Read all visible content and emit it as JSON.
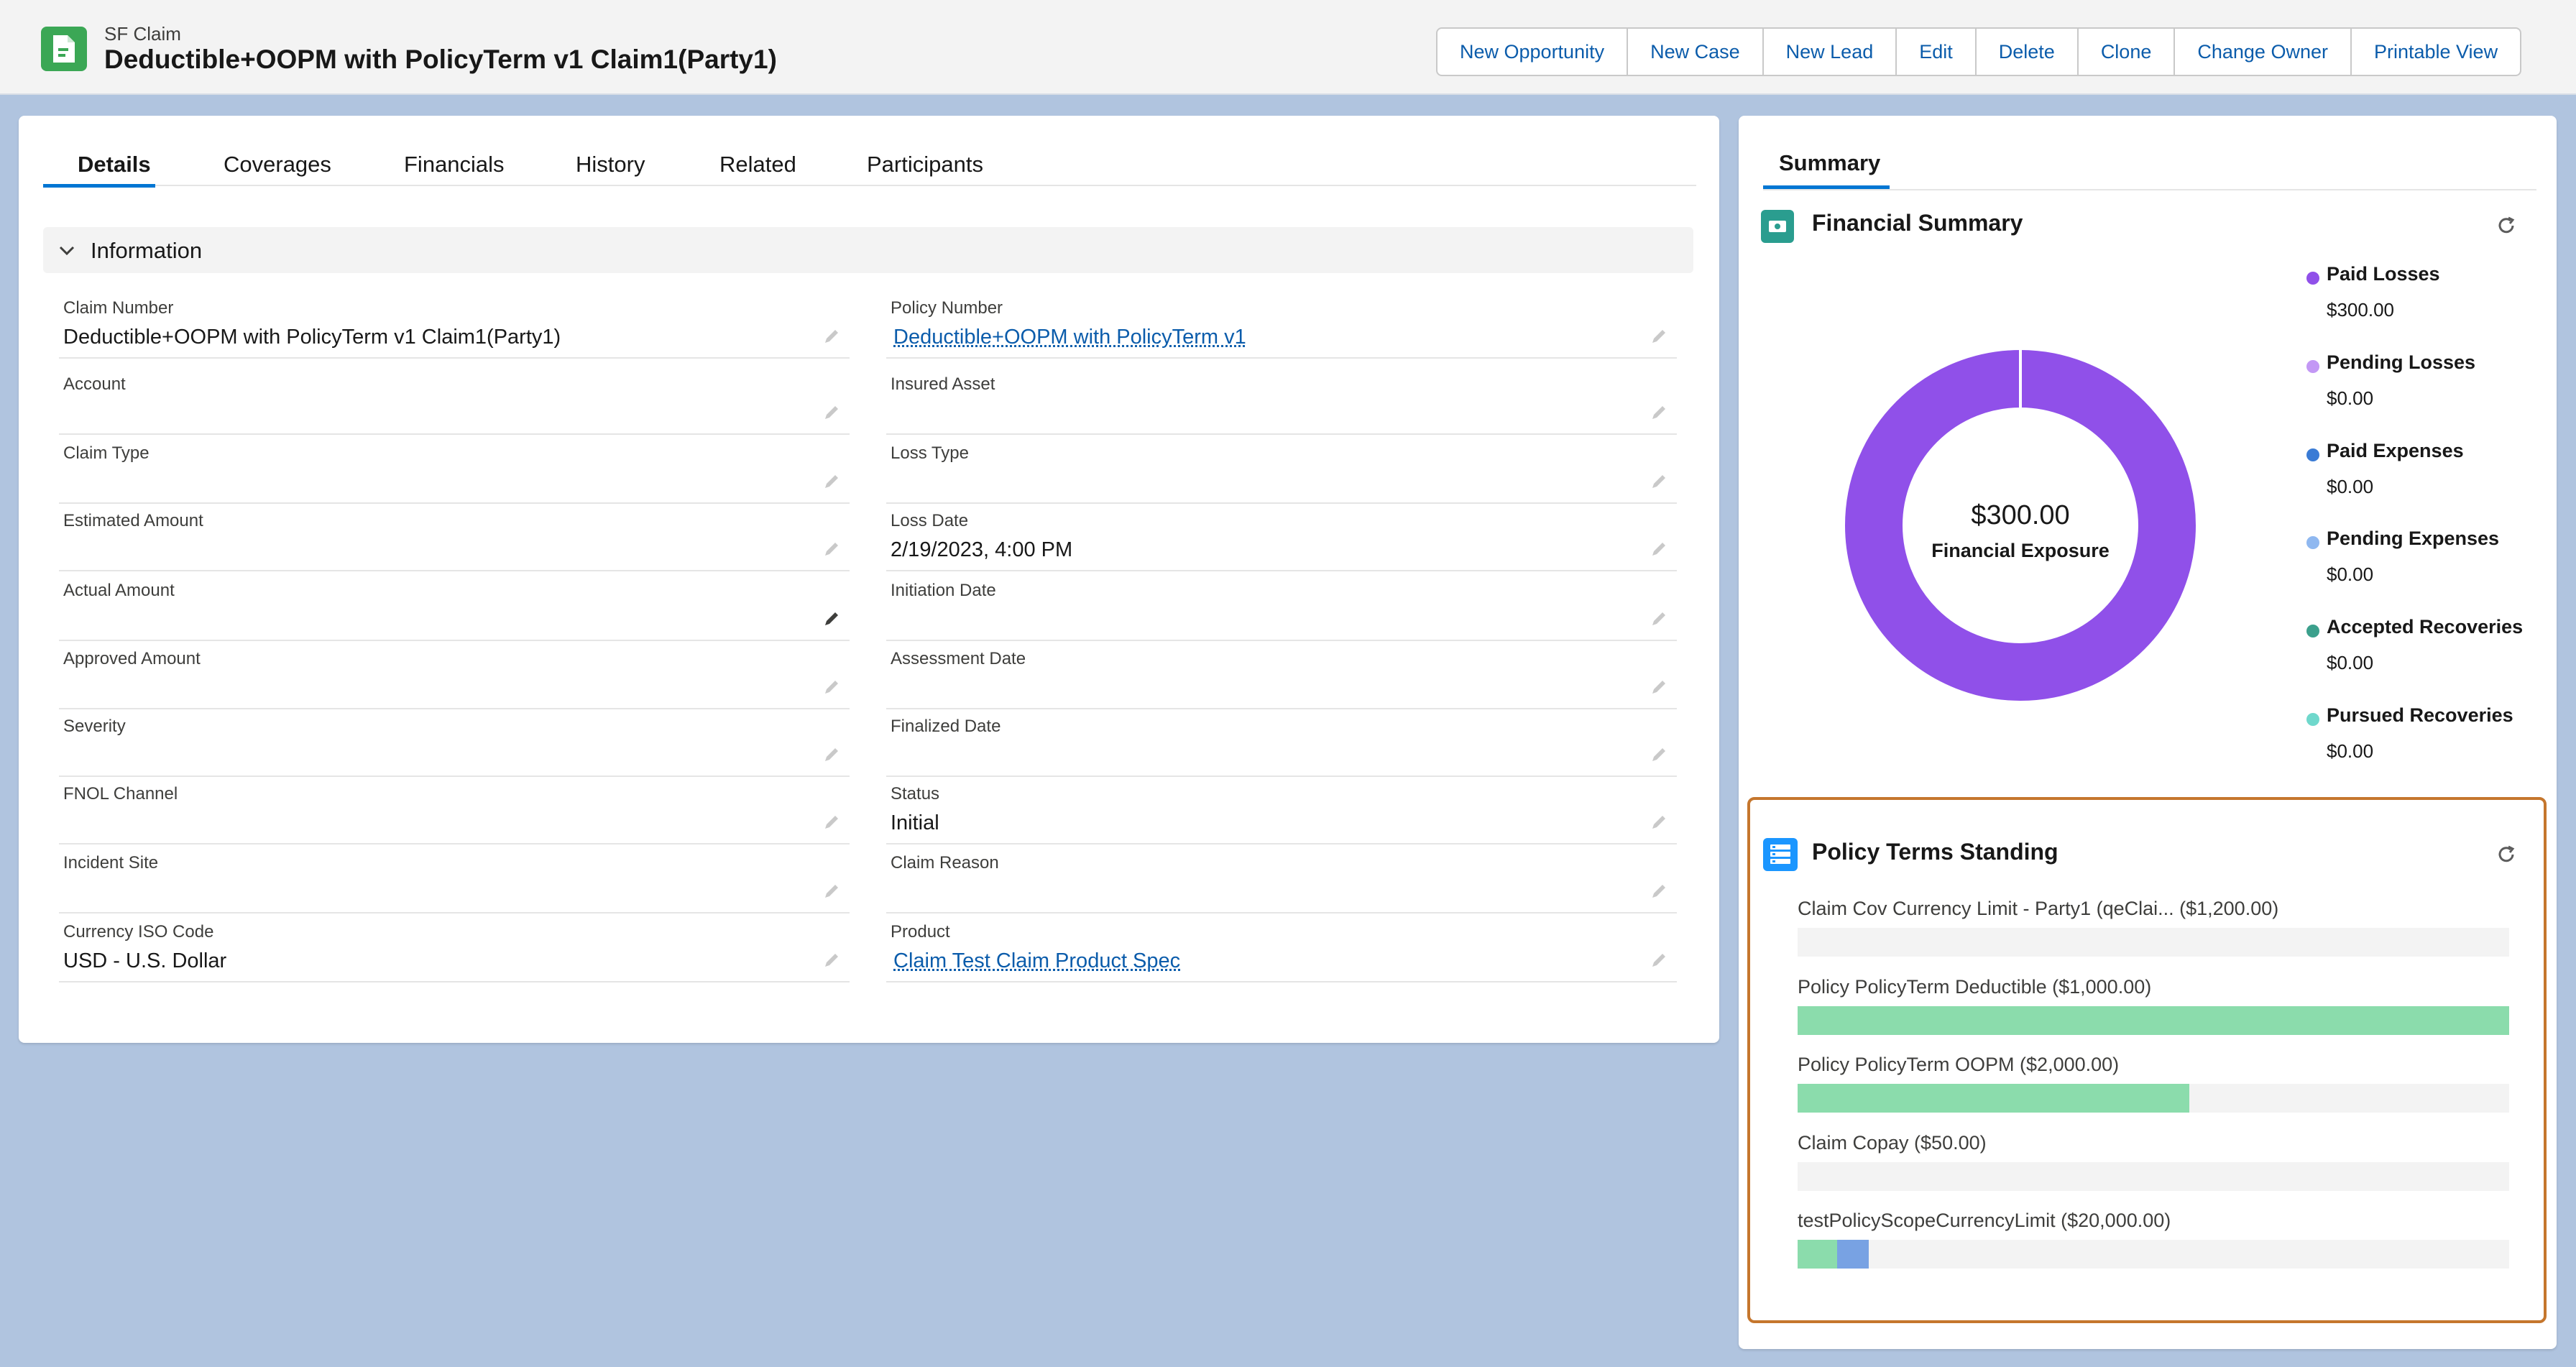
{
  "header": {
    "object_type": "SF Claim",
    "title": "Deductible+OOPM with PolicyTerm v1 Claim1(Party1)",
    "actions": [
      "New Opportunity",
      "New Case",
      "New Lead",
      "Edit",
      "Delete",
      "Clone",
      "Change Owner",
      "Printable View"
    ]
  },
  "tabs": [
    "Details",
    "Coverages",
    "Financials",
    "History",
    "Related",
    "Participants"
  ],
  "active_tab": "Details",
  "section": {
    "title": "Information"
  },
  "fields": {
    "claim_number": {
      "label": "Claim Number",
      "value": "Deductible+OOPM with PolicyTerm v1 Claim1(Party1)"
    },
    "policy_number": {
      "label": "Policy Number",
      "value": "Deductible+OOPM with PolicyTerm v1"
    },
    "account": {
      "label": "Account",
      "value": ""
    },
    "insured_asset": {
      "label": "Insured Asset",
      "value": ""
    },
    "claim_type": {
      "label": "Claim Type",
      "value": ""
    },
    "loss_type": {
      "label": "Loss Type",
      "value": ""
    },
    "estimated_amount": {
      "label": "Estimated Amount",
      "value": ""
    },
    "loss_date": {
      "label": "Loss Date",
      "value": "2/19/2023, 4:00 PM"
    },
    "actual_amount": {
      "label": "Actual Amount",
      "value": ""
    },
    "initiation_date": {
      "label": "Initiation Date",
      "value": ""
    },
    "approved_amount": {
      "label": "Approved Amount",
      "value": ""
    },
    "assessment_date": {
      "label": "Assessment Date",
      "value": ""
    },
    "severity": {
      "label": "Severity",
      "value": ""
    },
    "finalized_date": {
      "label": "Finalized Date",
      "value": ""
    },
    "fnol_channel": {
      "label": "FNOL Channel",
      "value": ""
    },
    "status": {
      "label": "Status",
      "value": "Initial"
    },
    "incident_site": {
      "label": "Incident Site",
      "value": ""
    },
    "claim_reason": {
      "label": "Claim Reason",
      "value": ""
    },
    "currency_iso_code": {
      "label": "Currency ISO Code",
      "value": "USD - U.S. Dollar"
    },
    "product": {
      "label": "Product",
      "value": "Claim Test Claim Product Spec"
    }
  },
  "summary": {
    "tab": "Summary",
    "financial_summary": {
      "title": "Financial Summary",
      "center_value": "$300.00",
      "center_label": "Financial Exposure",
      "legend": [
        {
          "name": "Paid Losses",
          "value": "$300.00",
          "color": "#9050e9"
        },
        {
          "name": "Pending Losses",
          "value": "$0.00",
          "color": "#c398f5"
        },
        {
          "name": "Paid Expenses",
          "value": "$0.00",
          "color": "#3a7bd5"
        },
        {
          "name": "Pending Expenses",
          "value": "$0.00",
          "color": "#8fb8f0"
        },
        {
          "name": "Accepted Recoveries",
          "value": "$0.00",
          "color": "#3ba08c"
        },
        {
          "name": "Pursued Recoveries",
          "value": "$0.00",
          "color": "#6fd8cc"
        }
      ],
      "donut_color": "#9050e9"
    },
    "policy_terms": {
      "title": "Policy Terms Standing",
      "bars": [
        {
          "label": "Claim Cov Currency Limit - Party1 (qeClai... ($1,200.00)",
          "segments": []
        },
        {
          "label": "Policy PolicyTerm Deductible ($1,000.00)",
          "segments": [
            {
              "fraction": 1.0,
              "color": "#8bdcac"
            }
          ]
        },
        {
          "label": "Policy PolicyTerm OOPM ($2,000.00)",
          "segments": [
            {
              "fraction": 0.55,
              "color": "#8bdcac"
            }
          ]
        },
        {
          "label": "Claim Copay ($50.00)",
          "segments": []
        },
        {
          "label": "testPolicyScopeCurrencyLimit ($20,000.00)",
          "segments": [
            {
              "fraction": 0.056,
              "color": "#8bdcac"
            },
            {
              "fraction": 0.044,
              "color": "#78a2e3"
            }
          ]
        }
      ]
    }
  }
}
